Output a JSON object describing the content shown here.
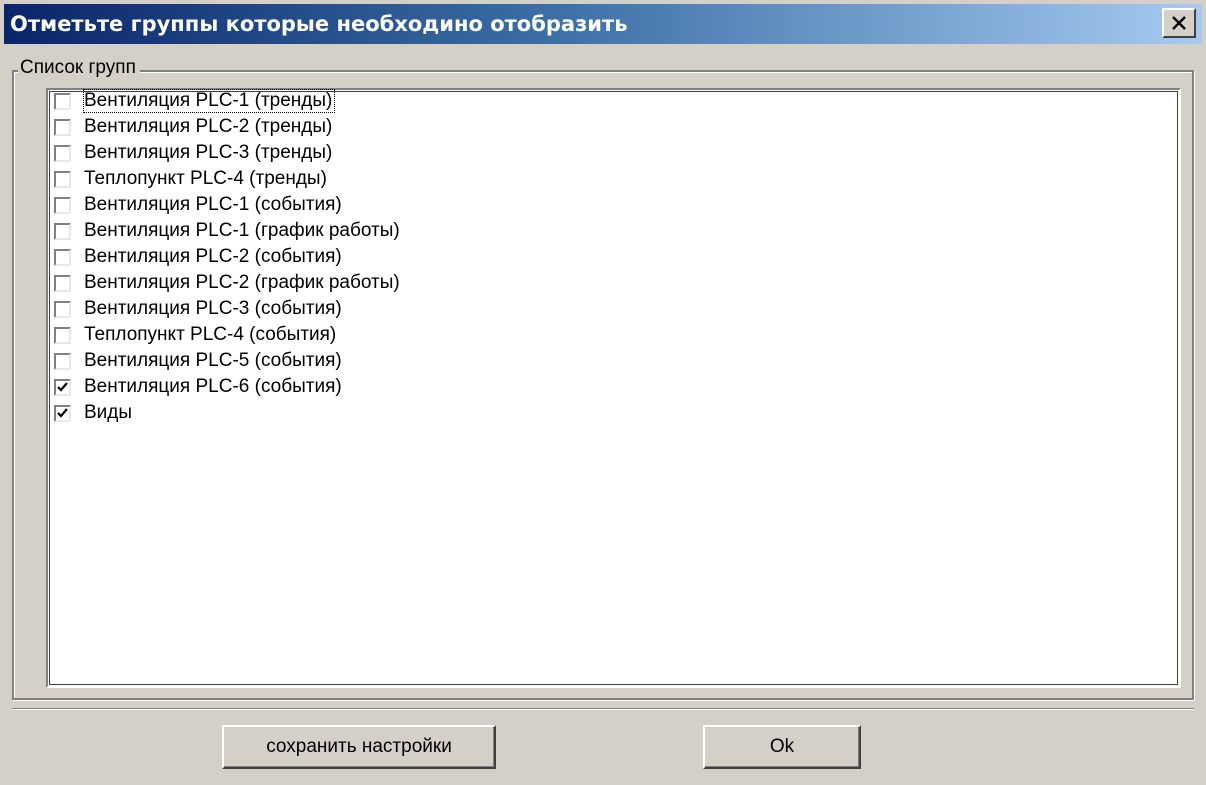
{
  "window": {
    "title": "Отметьте группы которые необходино отобразить",
    "close_icon": "close-icon"
  },
  "groupbox": {
    "label": "Список групп"
  },
  "items": [
    {
      "label": "Вентиляция PLC-1 (тренды)",
      "checked": false
    },
    {
      "label": "Вентиляция PLC-2 (тренды)",
      "checked": false
    },
    {
      "label": "Вентиляция PLC-3 (тренды)",
      "checked": false
    },
    {
      "label": "Теплопункт PLC-4 (тренды)",
      "checked": false
    },
    {
      "label": "Вентиляция PLC-1 (события)",
      "checked": false
    },
    {
      "label": "Вентиляция PLC-1 (график работы)",
      "checked": false
    },
    {
      "label": "Вентиляция PLC-2 (события)",
      "checked": false
    },
    {
      "label": "Вентиляция PLC-2 (график работы)",
      "checked": false
    },
    {
      "label": "Вентиляция PLC-3 (события)",
      "checked": false
    },
    {
      "label": "Теплопункт PLC-4 (события)",
      "checked": false
    },
    {
      "label": "Вентиляция PLC-5 (события)",
      "checked": false
    },
    {
      "label": "Вентиляция PLC-6 (события)",
      "checked": true
    },
    {
      "label": "Виды",
      "checked": true
    }
  ],
  "buttons": {
    "save_label": "сохранить настройки",
    "ok_label": "Ok"
  },
  "colors": {
    "titlebar_start": "#0a246a",
    "titlebar_end": "#a6caf0",
    "face": "#d4d0c8"
  }
}
